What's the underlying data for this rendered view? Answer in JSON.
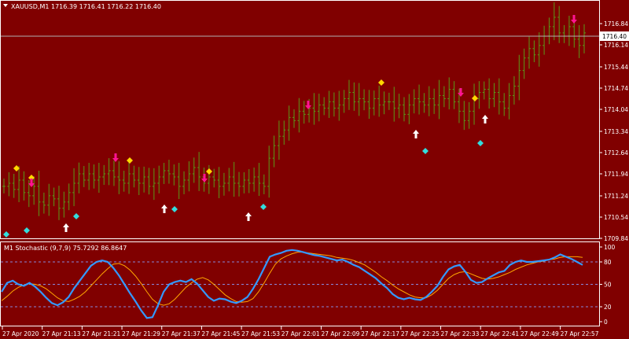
{
  "header": {
    "symbol_line": "XAUUSD,M1  1716.39 1716.41 1716.22 1716.40",
    "menu_icon": "triangle-down-icon"
  },
  "current_price_label": "1716.40",
  "price_axis_labels": [
    "1716.84",
    "1716.14",
    "1715.44",
    "1714.74",
    "1714.04",
    "1713.34",
    "1712.64",
    "1711.94",
    "1711.24",
    "1710.54",
    "1709.84"
  ],
  "indicator": {
    "title": "M1 Stochastic (9,7,9) 75.7292 86.8647",
    "axis_labels": [
      "100",
      "80",
      "50",
      "20",
      "0"
    ]
  },
  "time_axis_labels": [
    "27 Apr 2020",
    "27 Apr 21:13",
    "27 Apr 21:21",
    "27 Apr 21:29",
    "27 Apr 21:37",
    "27 Apr 21:45",
    "27 Apr 21:53",
    "27 Apr 22:01",
    "27 Apr 22:09",
    "27 Apr 22:17",
    "27 Apr 22:25",
    "27 Apr 22:33",
    "27 Apr 22:41",
    "27 Apr 22:49",
    "27 Apr 22:57"
  ],
  "colors": {
    "background": "#800000",
    "bars": "#5a9a1a",
    "stoch_main": "#3399ff",
    "stoch_signal": "#ffa500",
    "levels": "#8888dd",
    "marker_yellow": "#ffd700",
    "marker_cyan": "#33dddd",
    "arrow_magenta": "#ff1493",
    "arrow_white": "#ffffff"
  },
  "chart_data": [
    {
      "type": "line",
      "title": "XAUUSD,M1",
      "xlabel": "",
      "ylabel": "",
      "ylim": [
        1709.84,
        1717.1
      ],
      "series": [
        {
          "values": [
            1711.5,
            1711.6,
            1711.4,
            1711.7,
            1711.3,
            1711.2,
            1711.5,
            1711.0,
            1710.9,
            1711.2,
            1711.1,
            1710.8,
            1711.0,
            1711.3,
            1711.6,
            1711.9,
            1711.7,
            1711.9,
            1711.7,
            1711.8,
            1711.9,
            1712.0,
            1711.8,
            1711.7,
            1711.6,
            1711.9,
            1711.7,
            1711.6,
            1711.8,
            1711.5,
            1711.6,
            1711.8,
            1712.0,
            1711.9,
            1711.8,
            1711.5,
            1711.7,
            1711.9,
            1712.1,
            1711.8,
            1711.6,
            1711.8,
            1711.7,
            1711.5,
            1711.6,
            1711.8,
            1711.6,
            1711.5,
            1711.7,
            1711.6,
            1711.8,
            1711.6,
            1711.5,
            1712.4,
            1712.8,
            1713.1,
            1713.3,
            1713.7,
            1713.6,
            1713.9,
            1713.8,
            1714.0,
            1713.9,
            1714.1,
            1714.0,
            1714.2,
            1714.0,
            1714.1,
            1714.3,
            1714.5,
            1714.2,
            1714.3,
            1714.2,
            1714.0,
            1714.3,
            1714.1,
            1714.2,
            1714.2,
            1714.0,
            1714.1,
            1713.8,
            1714.1,
            1714.3,
            1714.2,
            1714.1,
            1714.3,
            1714.1,
            1714.4,
            1714.3,
            1714.6,
            1714.2,
            1713.9,
            1713.6,
            1713.9,
            1714.3,
            1714.5,
            1714.6,
            1714.3,
            1714.5,
            1714.2,
            1714.0,
            1714.4,
            1714.7,
            1715.2,
            1715.6,
            1715.9,
            1715.7,
            1716.0,
            1716.3,
            1716.6,
            1716.9,
            1716.4,
            1716.3,
            1716.6,
            1716.2,
            1716.0,
            1716.4
          ]
        }
      ]
    },
    {
      "type": "line",
      "title": "M1 Stochastic (9,7,9) 75.7292 86.8647",
      "xlabel": "",
      "ylabel": "",
      "ylim": [
        0,
        100
      ],
      "levels": [
        80,
        50,
        20
      ],
      "series": [
        {
          "values": [
            40,
            52,
            55,
            50,
            48,
            52,
            47,
            40,
            32,
            25,
            22,
            26,
            33,
            45,
            55,
            65,
            75,
            80,
            82,
            80,
            72,
            62,
            50,
            38,
            27,
            15,
            5,
            6,
            22,
            40,
            50,
            53,
            55,
            53,
            57,
            51,
            42,
            33,
            28,
            31,
            30,
            27,
            25,
            28,
            33,
            44,
            57,
            72,
            87,
            90,
            92,
            95,
            96,
            95,
            93,
            91,
            89,
            88,
            86,
            84,
            82,
            83,
            80,
            76,
            73,
            68,
            63,
            58,
            51,
            45,
            37,
            32,
            30,
            32,
            30,
            29,
            33,
            40,
            48,
            60,
            70,
            74,
            76,
            67,
            56,
            52,
            53,
            58,
            62,
            66,
            68,
            76,
            80,
            82,
            80,
            80,
            81,
            82,
            83,
            86,
            90,
            87,
            84,
            80,
            76
          ]
        },
        {
          "values": [
            28,
            34,
            41,
            46,
            49,
            51,
            50,
            48,
            44,
            38,
            32,
            28,
            27,
            30,
            34,
            40,
            48,
            56,
            64,
            71,
            77,
            78,
            75,
            69,
            61,
            51,
            40,
            30,
            24,
            22,
            24,
            30,
            38,
            46,
            52,
            57,
            59,
            56,
            50,
            43,
            36,
            31,
            27,
            26,
            27,
            31,
            40,
            52,
            65,
            77,
            84,
            88,
            91,
            93,
            93,
            92,
            91,
            90,
            89,
            88,
            86,
            85,
            84,
            82,
            79,
            76,
            71,
            66,
            60,
            55,
            49,
            44,
            40,
            36,
            33,
            32,
            32,
            36,
            42,
            50,
            58,
            63,
            66,
            67,
            64,
            61,
            58,
            57,
            58,
            60,
            63,
            66,
            70,
            73,
            76,
            78,
            80,
            81,
            83,
            84,
            86,
            87,
            87,
            87,
            86
          ]
        }
      ]
    }
  ]
}
